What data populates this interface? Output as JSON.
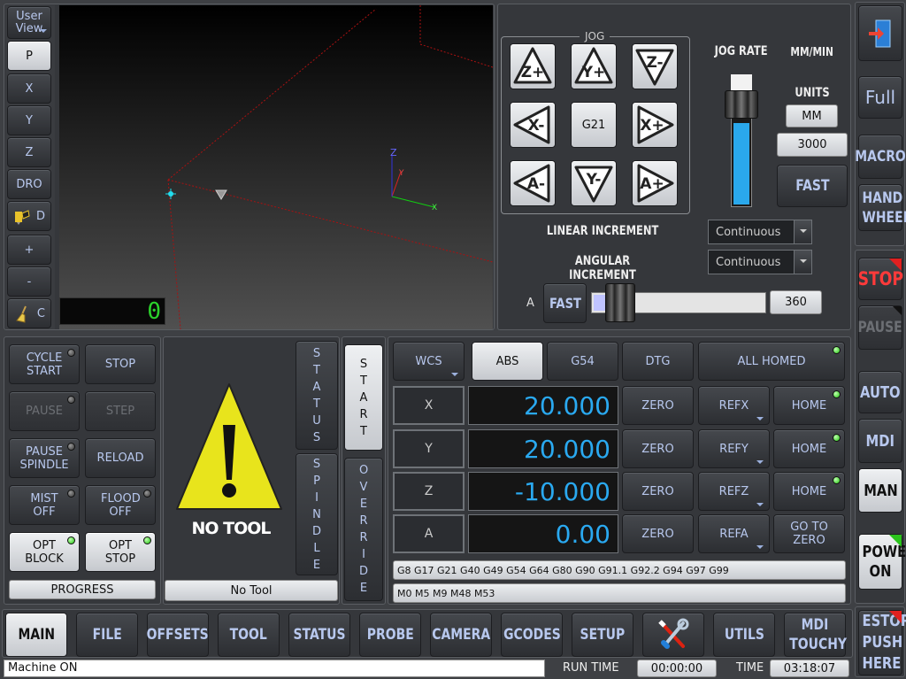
{
  "view": {
    "user_view": "User View",
    "buttons": [
      "P",
      "X",
      "Y",
      "Z",
      "DRO",
      "D",
      "+",
      "-",
      "C"
    ],
    "counter": "0",
    "axis_labels": {
      "z": "Z",
      "y": "Y",
      "x": "X"
    }
  },
  "jog": {
    "title": "JOG",
    "buttons": [
      "Z+",
      "Y+",
      "Z-",
      "X-",
      "G21",
      "X+",
      "A-",
      "Y-",
      "A+"
    ],
    "rate_label": "JOG RATE",
    "rate_fill": 0.62,
    "units_label": "MM/MIN",
    "units_section": "UNITS",
    "units_value": "MM",
    "rate_value": "3000",
    "fast": "FAST",
    "linear_label": "LINEAR INCREMENT",
    "linear_value": "Continuous",
    "angular_label": "ANGULAR INCREMENT",
    "angular_value": "Continuous",
    "a_label": "A",
    "a_fast": "FAST",
    "a_value": "360",
    "a_slider_fill": 0.12
  },
  "right": {
    "full": "Full",
    "macro": "MACRO",
    "handwheel": "HAND WHEEL",
    "stop": "STOP",
    "pause": "PAUSE",
    "auto": "AUTO",
    "mdi": "MDI",
    "man": "MAN",
    "power": "POWER ON",
    "estop": "ESTOP PUSH HERE"
  },
  "controls": {
    "cycle_start": "CYCLE START",
    "stop": "STOP",
    "pause": "PAUSE",
    "step": "STEP",
    "pause_spindle": "PAUSE SPINDLE",
    "reload": "RELOAD",
    "mist": "MIST OFF",
    "flood": "FLOOD OFF",
    "opt_block": "OPT BLOCK",
    "opt_stop": "OPT STOP",
    "progress": "PROGRESS"
  },
  "tool": {
    "no_tool": "NO TOOL",
    "tab_status": "STATUS",
    "tab_spindle": "SPINDLE",
    "status_label": "No Tool",
    "start": "START",
    "override": "OVERRIDE"
  },
  "dro": {
    "wcs": "WCS",
    "abs": "ABS",
    "g54": "G54",
    "dtg": "DTG",
    "all_homed": "ALL HOMED",
    "rows": [
      {
        "axis": "X",
        "value": "20.000",
        "zero": "ZERO",
        "ref": "REFX",
        "home": "HOME"
      },
      {
        "axis": "Y",
        "value": "20.000",
        "zero": "ZERO",
        "ref": "REFY",
        "home": "HOME"
      },
      {
        "axis": "Z",
        "value": "-10.000",
        "zero": "ZERO",
        "ref": "REFZ",
        "home": "HOME"
      },
      {
        "axis": "A",
        "value": "0.00",
        "zero": "ZERO",
        "ref": "REFA",
        "home": "GO TO ZERO"
      }
    ],
    "gcodes": "G8 G17 G21 G40 G49 G54 G64 G80 G90 G91.1 G92.2 G94 G97 G99",
    "mcodes": "M0 M5 M9 M48 M53"
  },
  "tabs": [
    "MAIN",
    "FILE",
    "OFFSETS",
    "TOOL",
    "STATUS",
    "PROBE",
    "CAMERA",
    "GCODES",
    "SETUP",
    "",
    "UTILS",
    "MDI TOUCHY"
  ],
  "status": {
    "message": "Machine ON",
    "run_time_label": "RUN TIME",
    "run_time": "00:00:00",
    "time_label": "TIME",
    "time": "03:18:07"
  }
}
